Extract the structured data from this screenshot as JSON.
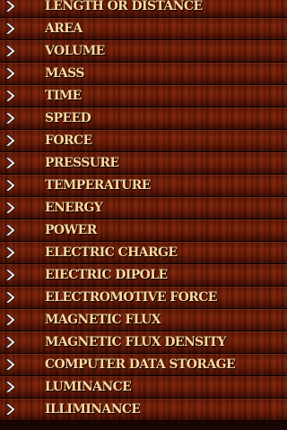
{
  "categories": [
    {
      "label": "LENGTH OR DISTANCE",
      "icon": "chevron-right-icon"
    },
    {
      "label": "AREA",
      "icon": "chevron-right-icon"
    },
    {
      "label": "VOLUME",
      "icon": "chevron-right-icon"
    },
    {
      "label": "MASS",
      "icon": "chevron-right-icon"
    },
    {
      "label": "TIME",
      "icon": "chevron-right-icon"
    },
    {
      "label": "SPEED",
      "icon": "chevron-right-icon"
    },
    {
      "label": "FORCE",
      "icon": "chevron-right-icon"
    },
    {
      "label": "PRESSURE",
      "icon": "chevron-right-icon"
    },
    {
      "label": "TEMPERATURE",
      "icon": "chevron-right-icon"
    },
    {
      "label": "ENERGY",
      "icon": "chevron-right-icon"
    },
    {
      "label": "POWER",
      "icon": "chevron-right-icon"
    },
    {
      "label": "ELECTRIC CHARGE",
      "icon": "chevron-right-icon"
    },
    {
      "label": "EIECTRIC DIPOLE",
      "icon": "chevron-right-icon"
    },
    {
      "label": "ELECTROMOTIVE FORCE",
      "icon": "chevron-right-icon"
    },
    {
      "label": "MAGNETIC FLUX",
      "icon": "chevron-right-icon"
    },
    {
      "label": "MAGNETIC FLUX DENSITY",
      "icon": "chevron-right-icon"
    },
    {
      "label": "COMPUTER DATA STORAGE",
      "icon": "chevron-right-icon"
    },
    {
      "label": "LUMINANCE",
      "icon": "chevron-right-icon"
    },
    {
      "label": "ILLIMINANCE",
      "icon": "chevron-right-icon"
    }
  ],
  "colors": {
    "text": "#ffd9a0",
    "wood_dark": "#3a0c03",
    "wood_mid": "#7a220b",
    "separator": "#080100",
    "chevron": "#f2f2f2"
  }
}
